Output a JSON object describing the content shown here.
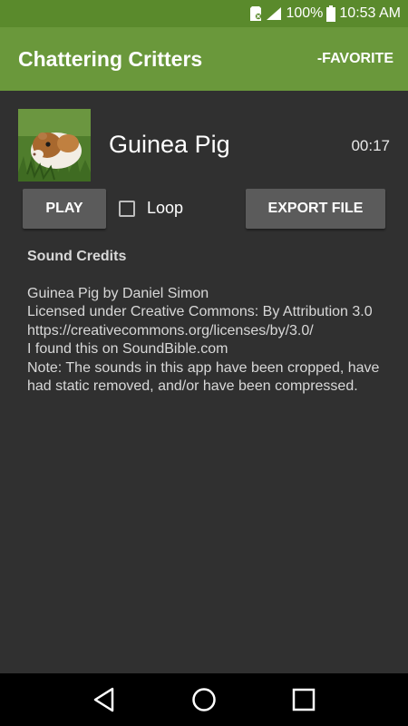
{
  "status_bar": {
    "battery": "100%",
    "time": "10:53 AM"
  },
  "app_bar": {
    "title": "Chattering Critters",
    "action_label": "-FAVORITE"
  },
  "sound": {
    "name": "Guinea Pig",
    "duration": "00:17",
    "thumbnail_icon": "guinea-pig-photo"
  },
  "controls": {
    "play_label": "PLAY",
    "loop_label": "Loop",
    "loop_checked": false,
    "export_label": "EXPORT FILE"
  },
  "credits": {
    "heading": "Sound Credits",
    "lines": [
      "Guinea Pig by Daniel Simon",
      "Licensed under Creative Commons: By Attribution 3.0",
      "https://creativecommons.org/licenses/by/3.0/",
      "I found this on SoundBible.com"
    ],
    "note": "Note: The sounds in this app have been cropped, have had static removed, and/or have been compressed."
  },
  "nav_bar": {
    "icons": [
      "back-icon",
      "home-icon",
      "recents-icon"
    ]
  },
  "colors": {
    "status_bar": "#5a8a2c",
    "app_bar": "#6a983b",
    "background": "#303030",
    "button": "#5b5b5b"
  }
}
